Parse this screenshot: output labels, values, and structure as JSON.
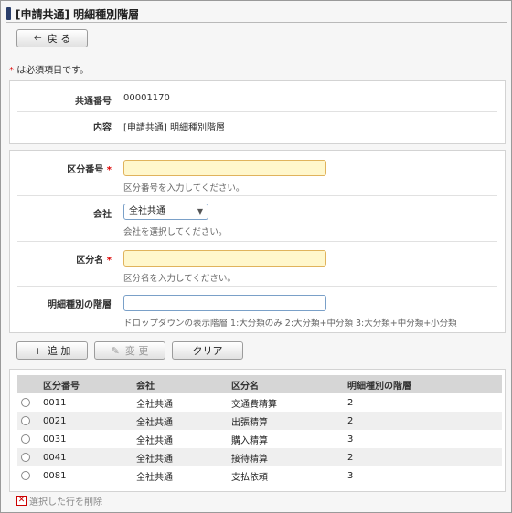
{
  "page": {
    "title": "[申請共通] 明細種別階層"
  },
  "toolbar": {
    "back_label": "戻 る"
  },
  "required_note": "は必須項目です。",
  "required_mark": "*",
  "info": {
    "rows": [
      {
        "label": "共通番号",
        "value": "00001170"
      },
      {
        "label": "内容",
        "value": "[申請共通] 明細種別階層"
      }
    ]
  },
  "form": {
    "category_no": {
      "label": "区分番号",
      "value": "",
      "hint": "区分番号を入力してください。"
    },
    "company": {
      "label": "会社",
      "value": "全社共通",
      "hint": "会社を選択してください。"
    },
    "category_name": {
      "label": "区分名",
      "value": "",
      "hint": "区分名を入力してください。"
    },
    "detail_level": {
      "label": "明細種別の階層",
      "value": "",
      "hint": "ドロップダウンの表示階層 1:大分類のみ 2:大分類+中分類 3:大分類+中分類+小分類"
    }
  },
  "actions": {
    "add_label": "追 加",
    "edit_label": "変 更",
    "clear_label": "クリア"
  },
  "table": {
    "columns": [
      "区分番号",
      "会社",
      "区分名",
      "明細種別の階層"
    ],
    "rows": [
      [
        "0011",
        "全社共通",
        "交通費精算",
        "2"
      ],
      [
        "0021",
        "全社共通",
        "出張精算",
        "2"
      ],
      [
        "0031",
        "全社共通",
        "購入精算",
        "3"
      ],
      [
        "0041",
        "全社共通",
        "接待精算",
        "2"
      ],
      [
        "0081",
        "全社共通",
        "支払依頼",
        "3"
      ]
    ]
  },
  "delete_label": "選択した行を削除",
  "colors": {
    "title_mark": "#2b3f6c",
    "required": "#dd0000",
    "required_input_bg": "#fff7cc",
    "header_bg": "#d6d6d6"
  },
  "icons": {
    "back": "arrow-left-icon",
    "add": "plus-icon",
    "edit": "pencil-icon",
    "delete": "delete-x-icon"
  }
}
